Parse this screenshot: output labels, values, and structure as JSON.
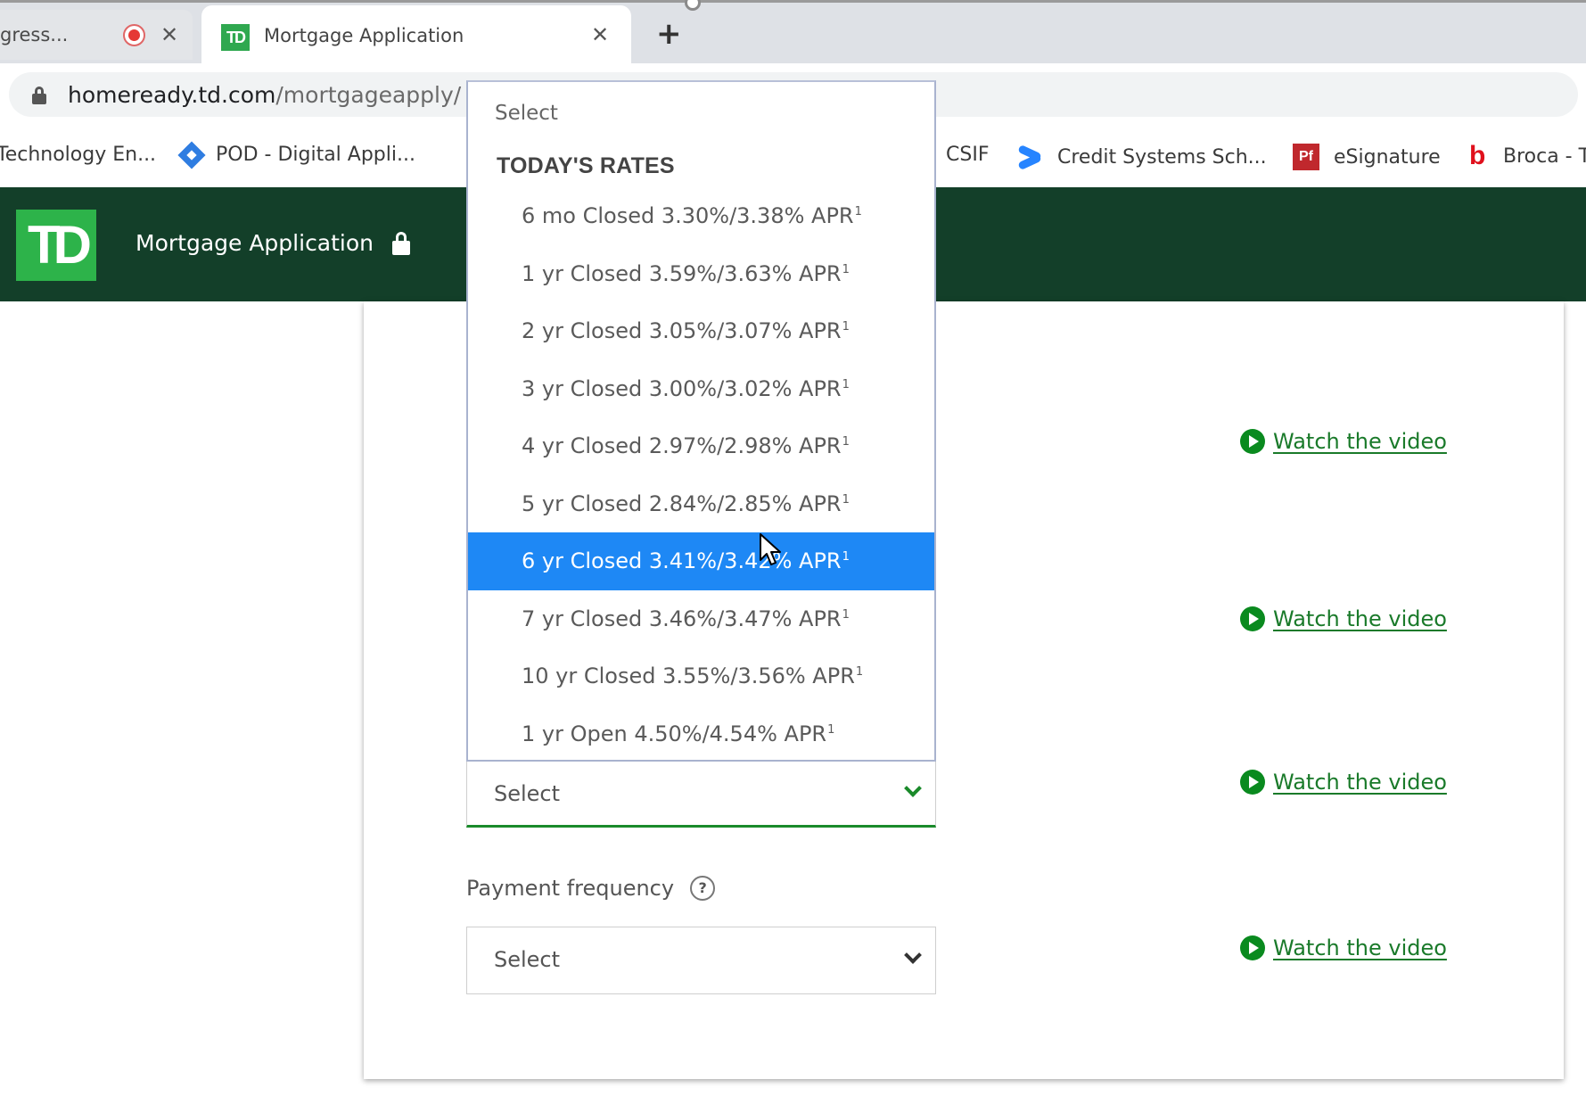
{
  "browser": {
    "tabs": [
      {
        "title": "gress...",
        "recording": true,
        "active": false
      },
      {
        "title": "Mortgage Application",
        "favicon": "TD",
        "active": true
      }
    ],
    "tab_close_glyph": "✕",
    "new_tab_glyph": "+",
    "url_host": "homeready.td.com",
    "url_path": "/mortgageapply/",
    "bookmarks": [
      {
        "label": "Technology En...",
        "icon": "none"
      },
      {
        "label": "POD - Digital Appli...",
        "icon": "jira-diamond-icon"
      },
      {
        "label": "CSIF",
        "icon": "confluence-icon"
      },
      {
        "label": "Credit Systems Sch...",
        "icon": "confluence-icon"
      },
      {
        "label": "eSignature",
        "icon": "pf-icon"
      },
      {
        "label": "Broca - T",
        "icon": "b-icon"
      }
    ],
    "pf_icon_text": "Pf",
    "b_icon_text": "b"
  },
  "header": {
    "logo_text": "TD",
    "title": "Mortgage Application"
  },
  "dropdown": {
    "placeholder": "Select",
    "group_label": "TODAY'S RATES",
    "selected_index": 6,
    "options": [
      {
        "term": "6 mo Closed",
        "rate": "3.30%",
        "apr": "3.38%",
        "label": "6 mo Closed 3.30%/3.38% APR",
        "footnote": "1"
      },
      {
        "term": "1 yr Closed",
        "rate": "3.59%",
        "apr": "3.63%",
        "label": "1 yr Closed 3.59%/3.63% APR",
        "footnote": "1"
      },
      {
        "term": "2 yr Closed",
        "rate": "3.05%",
        "apr": "3.07%",
        "label": "2 yr Closed 3.05%/3.07% APR",
        "footnote": "1"
      },
      {
        "term": "3 yr Closed",
        "rate": "3.00%",
        "apr": "3.02%",
        "label": "3 yr Closed 3.00%/3.02% APR",
        "footnote": "1"
      },
      {
        "term": "4 yr Closed",
        "rate": "2.97%",
        "apr": "2.98%",
        "label": "4 yr Closed 2.97%/2.98% APR",
        "footnote": "1"
      },
      {
        "term": "5 yr Closed",
        "rate": "2.84%",
        "apr": "2.85%",
        "label": "5 yr Closed 2.84%/2.85% APR",
        "footnote": "1"
      },
      {
        "term": "6 yr Closed",
        "rate": "3.41%",
        "apr": "3.42%",
        "label": "6 yr Closed 3.41%/3.42% APR",
        "footnote": "1"
      },
      {
        "term": "7 yr Closed",
        "rate": "3.46%",
        "apr": "3.47%",
        "label": "7 yr Closed 3.46%/3.47% APR",
        "footnote": "1"
      },
      {
        "term": "10 yr Closed",
        "rate": "3.55%",
        "apr": "3.56%",
        "label": "10 yr Closed 3.55%/3.56% APR",
        "footnote": "1"
      },
      {
        "term": "1 yr Open",
        "rate": "4.50%",
        "apr": "4.54%",
        "label": "1 yr Open 4.50%/4.54% APR",
        "footnote": "1"
      }
    ]
  },
  "form": {
    "rate_select_value": "Select",
    "payment_frequency_label": "Payment frequency",
    "help_glyph": "?",
    "payment_frequency_value": "Select"
  },
  "video_links": [
    {
      "label": "Watch the video"
    },
    {
      "label": "Watch the video"
    },
    {
      "label": "Watch the video"
    },
    {
      "label": "Watch the video"
    }
  ],
  "colors": {
    "td_dark_green": "#133f29",
    "td_green": "#2db34a",
    "link_green": "#1a7a2a",
    "selected_option": "#1e88f5"
  }
}
